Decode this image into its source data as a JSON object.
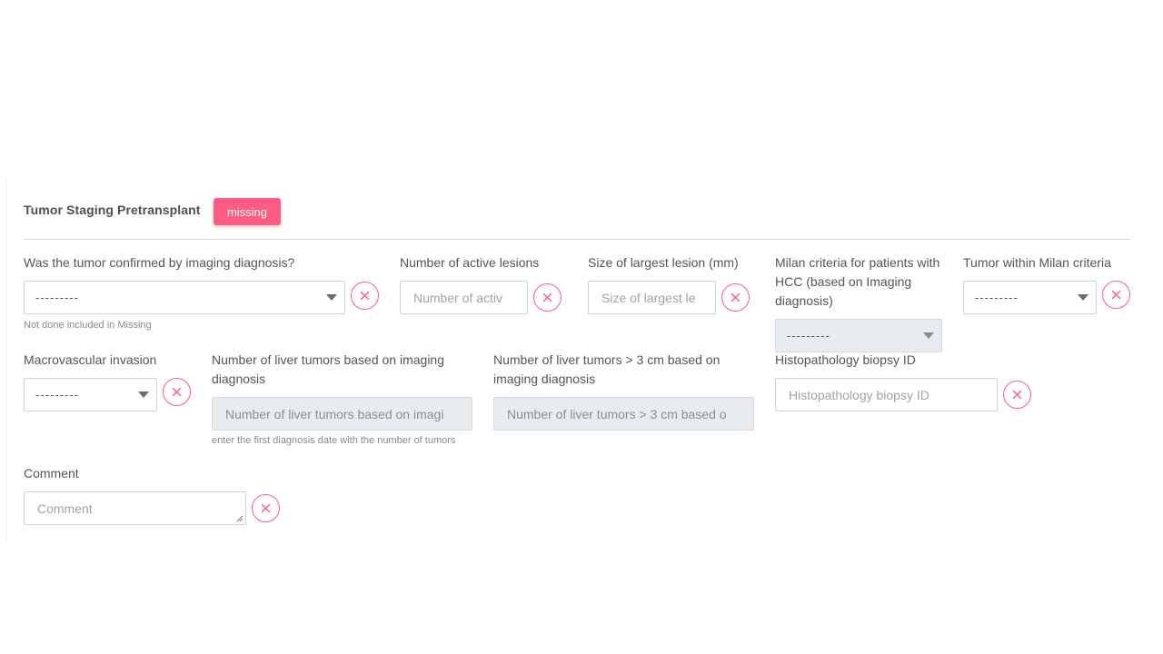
{
  "section": {
    "title": "Tumor Staging Pretransplant",
    "badge": "missing"
  },
  "fields": {
    "imaging_confirmed": {
      "label": "Was the tumor confirmed by imaging diagnosis?",
      "value": "---------",
      "help": "Not done included in Missing"
    },
    "active_lesions": {
      "label": "Number of active lesions",
      "placeholder": "Number of activ"
    },
    "largest_lesion": {
      "label": "Size of largest lesion (mm)",
      "placeholder": "Size of largest le"
    },
    "milan_hcc": {
      "label": "Milan criteria for patients with HCC (based on Imaging diagnosis)",
      "value": "---------"
    },
    "within_milan": {
      "label": "Tumor within Milan criteria",
      "value": "---------"
    },
    "macrovascular": {
      "label": "Macrovascular invasion",
      "value": "---------"
    },
    "liver_tumors": {
      "label": "Number of liver tumors based on imaging diagnosis",
      "placeholder": "Number of liver tumors based on imagi",
      "help": "enter the first diagnosis date with the number of tumors"
    },
    "liver_tumors_3cm": {
      "label": "Number of liver tumors > 3 cm based on imaging diagnosis",
      "placeholder": "Number of liver tumors > 3 cm based o"
    },
    "biopsy_id": {
      "label": "Histopathology biopsy ID",
      "placeholder": "Histopathology biopsy ID"
    },
    "comment": {
      "label": "Comment",
      "placeholder": "Comment"
    }
  },
  "icons": {
    "clear": "close-icon",
    "dropdown": "chevron-down-icon"
  },
  "colors": {
    "accent": "#ff5c82",
    "border": "#cfd4da",
    "disabled_bg": "#e9ecef"
  }
}
